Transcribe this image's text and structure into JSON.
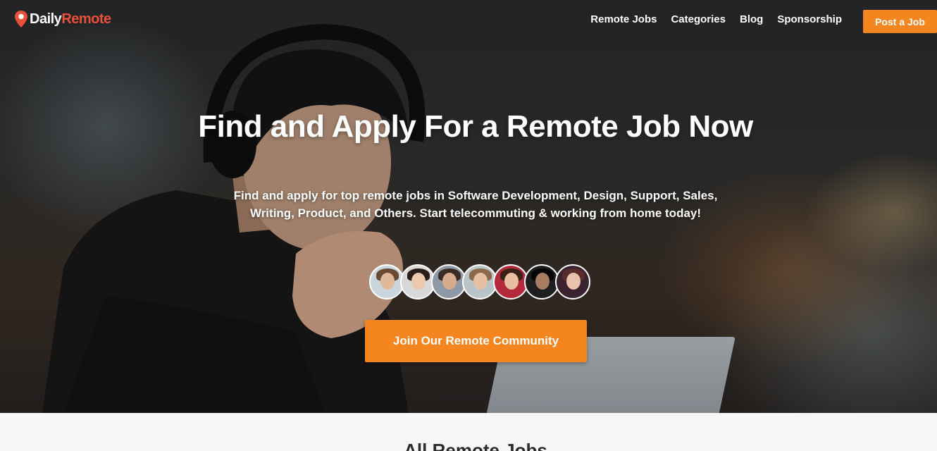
{
  "nav": {
    "logo_daily": "Daily",
    "logo_remote": "Remote",
    "links": [
      "Remote Jobs",
      "Categories",
      "Blog",
      "Sponsorship"
    ],
    "post_button": "Post a Job"
  },
  "hero": {
    "headline": "Find and Apply For a Remote Job Now",
    "subtext": "Find and apply for top remote jobs in Software Development, Design, Support, Sales, Writing, Product, and Others. Start telecommuting & working from home today!",
    "avatar_count": 7,
    "join_button": "Join Our Remote Community"
  },
  "section": {
    "title": "All Remote Jobs"
  },
  "colors": {
    "accent": "#f5851f",
    "logo_red": "#e8503a"
  }
}
